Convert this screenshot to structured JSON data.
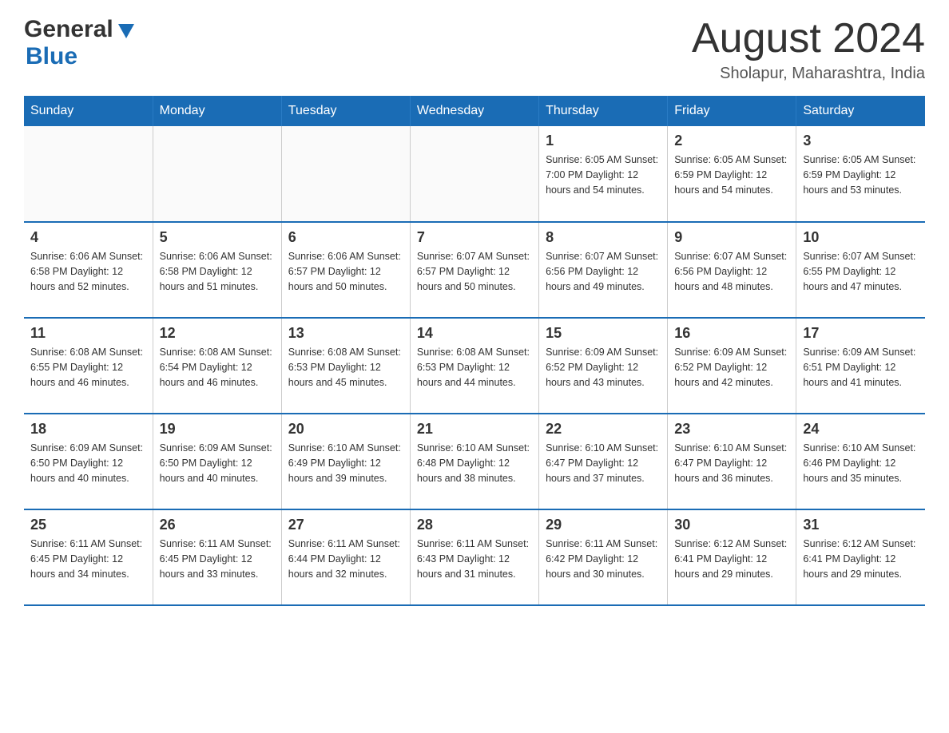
{
  "logo": {
    "general": "General",
    "blue": "Blue",
    "triangle": "▶"
  },
  "title": {
    "month": "August 2024",
    "location": "Sholapur, Maharashtra, India"
  },
  "days_of_week": [
    "Sunday",
    "Monday",
    "Tuesday",
    "Wednesday",
    "Thursday",
    "Friday",
    "Saturday"
  ],
  "weeks": [
    [
      {
        "day": "",
        "info": ""
      },
      {
        "day": "",
        "info": ""
      },
      {
        "day": "",
        "info": ""
      },
      {
        "day": "",
        "info": ""
      },
      {
        "day": "1",
        "info": "Sunrise: 6:05 AM\nSunset: 7:00 PM\nDaylight: 12 hours\nand 54 minutes."
      },
      {
        "day": "2",
        "info": "Sunrise: 6:05 AM\nSunset: 6:59 PM\nDaylight: 12 hours\nand 54 minutes."
      },
      {
        "day": "3",
        "info": "Sunrise: 6:05 AM\nSunset: 6:59 PM\nDaylight: 12 hours\nand 53 minutes."
      }
    ],
    [
      {
        "day": "4",
        "info": "Sunrise: 6:06 AM\nSunset: 6:58 PM\nDaylight: 12 hours\nand 52 minutes."
      },
      {
        "day": "5",
        "info": "Sunrise: 6:06 AM\nSunset: 6:58 PM\nDaylight: 12 hours\nand 51 minutes."
      },
      {
        "day": "6",
        "info": "Sunrise: 6:06 AM\nSunset: 6:57 PM\nDaylight: 12 hours\nand 50 minutes."
      },
      {
        "day": "7",
        "info": "Sunrise: 6:07 AM\nSunset: 6:57 PM\nDaylight: 12 hours\nand 50 minutes."
      },
      {
        "day": "8",
        "info": "Sunrise: 6:07 AM\nSunset: 6:56 PM\nDaylight: 12 hours\nand 49 minutes."
      },
      {
        "day": "9",
        "info": "Sunrise: 6:07 AM\nSunset: 6:56 PM\nDaylight: 12 hours\nand 48 minutes."
      },
      {
        "day": "10",
        "info": "Sunrise: 6:07 AM\nSunset: 6:55 PM\nDaylight: 12 hours\nand 47 minutes."
      }
    ],
    [
      {
        "day": "11",
        "info": "Sunrise: 6:08 AM\nSunset: 6:55 PM\nDaylight: 12 hours\nand 46 minutes."
      },
      {
        "day": "12",
        "info": "Sunrise: 6:08 AM\nSunset: 6:54 PM\nDaylight: 12 hours\nand 46 minutes."
      },
      {
        "day": "13",
        "info": "Sunrise: 6:08 AM\nSunset: 6:53 PM\nDaylight: 12 hours\nand 45 minutes."
      },
      {
        "day": "14",
        "info": "Sunrise: 6:08 AM\nSunset: 6:53 PM\nDaylight: 12 hours\nand 44 minutes."
      },
      {
        "day": "15",
        "info": "Sunrise: 6:09 AM\nSunset: 6:52 PM\nDaylight: 12 hours\nand 43 minutes."
      },
      {
        "day": "16",
        "info": "Sunrise: 6:09 AM\nSunset: 6:52 PM\nDaylight: 12 hours\nand 42 minutes."
      },
      {
        "day": "17",
        "info": "Sunrise: 6:09 AM\nSunset: 6:51 PM\nDaylight: 12 hours\nand 41 minutes."
      }
    ],
    [
      {
        "day": "18",
        "info": "Sunrise: 6:09 AM\nSunset: 6:50 PM\nDaylight: 12 hours\nand 40 minutes."
      },
      {
        "day": "19",
        "info": "Sunrise: 6:09 AM\nSunset: 6:50 PM\nDaylight: 12 hours\nand 40 minutes."
      },
      {
        "day": "20",
        "info": "Sunrise: 6:10 AM\nSunset: 6:49 PM\nDaylight: 12 hours\nand 39 minutes."
      },
      {
        "day": "21",
        "info": "Sunrise: 6:10 AM\nSunset: 6:48 PM\nDaylight: 12 hours\nand 38 minutes."
      },
      {
        "day": "22",
        "info": "Sunrise: 6:10 AM\nSunset: 6:47 PM\nDaylight: 12 hours\nand 37 minutes."
      },
      {
        "day": "23",
        "info": "Sunrise: 6:10 AM\nSunset: 6:47 PM\nDaylight: 12 hours\nand 36 minutes."
      },
      {
        "day": "24",
        "info": "Sunrise: 6:10 AM\nSunset: 6:46 PM\nDaylight: 12 hours\nand 35 minutes."
      }
    ],
    [
      {
        "day": "25",
        "info": "Sunrise: 6:11 AM\nSunset: 6:45 PM\nDaylight: 12 hours\nand 34 minutes."
      },
      {
        "day": "26",
        "info": "Sunrise: 6:11 AM\nSunset: 6:45 PM\nDaylight: 12 hours\nand 33 minutes."
      },
      {
        "day": "27",
        "info": "Sunrise: 6:11 AM\nSunset: 6:44 PM\nDaylight: 12 hours\nand 32 minutes."
      },
      {
        "day": "28",
        "info": "Sunrise: 6:11 AM\nSunset: 6:43 PM\nDaylight: 12 hours\nand 31 minutes."
      },
      {
        "day": "29",
        "info": "Sunrise: 6:11 AM\nSunset: 6:42 PM\nDaylight: 12 hours\nand 30 minutes."
      },
      {
        "day": "30",
        "info": "Sunrise: 6:12 AM\nSunset: 6:41 PM\nDaylight: 12 hours\nand 29 minutes."
      },
      {
        "day": "31",
        "info": "Sunrise: 6:12 AM\nSunset: 6:41 PM\nDaylight: 12 hours\nand 29 minutes."
      }
    ]
  ]
}
